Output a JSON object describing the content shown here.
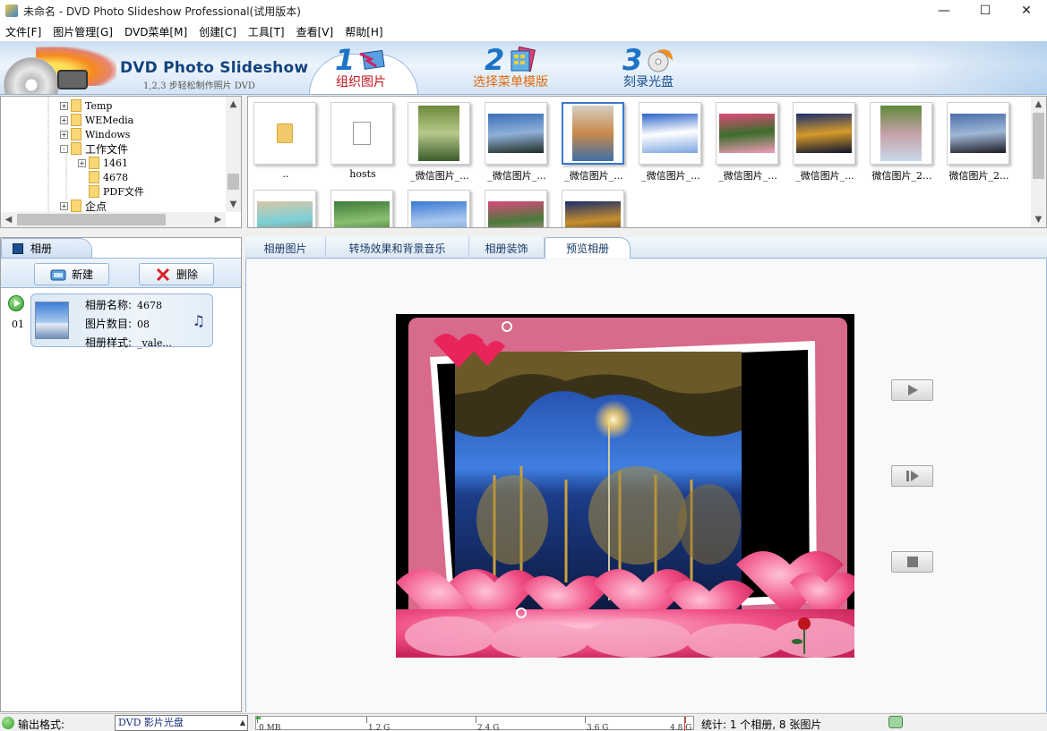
{
  "window": {
    "title": "未命名 - DVD Photo Slideshow Professional(试用版本)",
    "controls": [
      "minimize",
      "maximize",
      "close"
    ]
  },
  "menu": [
    "文件[F]",
    "图片管理[G]",
    "DVD菜单[M]",
    "创建[C]",
    "工具[T]",
    "查看[V]",
    "帮助[H]"
  ],
  "banner": {
    "brand": "DVD Photo Slideshow",
    "subtitle": "1,2,3 步轻松制作照片 DVD",
    "steps": [
      {
        "num": "1",
        "label": "组织图片",
        "active": true,
        "color": "#c0141c"
      },
      {
        "num": "2",
        "label": "选择菜单模版",
        "active": false,
        "color": "#e06a10"
      },
      {
        "num": "3",
        "label": "刻录光盘",
        "active": false,
        "color": "#1a4f8f"
      }
    ]
  },
  "tree": {
    "items": [
      {
        "label": "Temp",
        "expander": "+"
      },
      {
        "label": "WEMedia",
        "expander": "+"
      },
      {
        "label": "Windows",
        "expander": "+"
      },
      {
        "label": "工作文件",
        "expander": "-"
      },
      {
        "label": "1461",
        "expander": "+"
      },
      {
        "label": "4678",
        "expander": ""
      },
      {
        "label": "PDF文件",
        "expander": ""
      },
      {
        "label": "企点",
        "expander": "+"
      }
    ]
  },
  "thumbnails": [
    {
      "label": "..",
      "kind": "folder"
    },
    {
      "label": "hosts",
      "kind": "file"
    },
    {
      "label": "_微信图片_...",
      "kind": "photo",
      "colors": [
        "#6c8a3a",
        "#b6c98a",
        "#3a5a2a"
      ]
    },
    {
      "label": "_微信图片_...",
      "kind": "photo",
      "colors": [
        "#3a6fb8",
        "#8fb0d8",
        "#1f2d22"
      ]
    },
    {
      "label": "_微信图片_...",
      "kind": "photo",
      "colors": [
        "#d5cfc3",
        "#c88a4a",
        "#3e6fa8"
      ],
      "selected": true
    },
    {
      "label": "_微信图片_...",
      "kind": "photo",
      "colors": [
        "#2b63c9",
        "#ffffff",
        "#7aa6e0"
      ]
    },
    {
      "label": "_微信图片_...",
      "kind": "photo",
      "colors": [
        "#e04a7a",
        "#3c6e2c",
        "#f29bb8"
      ]
    },
    {
      "label": "_微信图片_...",
      "kind": "photo",
      "colors": [
        "#1a2e6e",
        "#d59a2a",
        "#0d1430"
      ]
    },
    {
      "label": "微信图片_2...",
      "kind": "photo",
      "colors": [
        "#5f8a3c",
        "#c6a0a6",
        "#c8d8ea"
      ]
    },
    {
      "label": "微信图片_2...",
      "kind": "photo",
      "colors": [
        "#4a6ea8",
        "#9fb7d6",
        "#1c1c24"
      ]
    },
    {
      "label": "",
      "kind": "photo",
      "colors": [
        "#d9c7a8",
        "#7ad0d8",
        "#a46a3a"
      ]
    },
    {
      "label": "",
      "kind": "photo",
      "colors": [
        "#3e7a3a",
        "#8ac070",
        "#2b4d22"
      ]
    },
    {
      "label": "",
      "kind": "photo",
      "colors": [
        "#3a78d4",
        "#a8c8ee",
        "#6a9ad6"
      ]
    },
    {
      "label": "",
      "kind": "photo",
      "colors": [
        "#d84a7c",
        "#4a7a3a",
        "#f0a0c0"
      ]
    },
    {
      "label": "",
      "kind": "photo",
      "colors": [
        "#1c2e6a",
        "#c88f2c",
        "#0f1530"
      ]
    }
  ],
  "album_panel": {
    "tab": "相册",
    "new_button": "新建",
    "delete_button": "删除",
    "albums": [
      {
        "index": "01",
        "name_label": "相册名称:",
        "name": "4678",
        "count_label": "图片数目:",
        "count": "08",
        "style_label": "相册样式:",
        "style": "_vale..."
      }
    ]
  },
  "tabs": [
    {
      "label": "相册图片",
      "active": false
    },
    {
      "label": "转场效果和背景音乐",
      "active": false
    },
    {
      "label": "相册装饰",
      "active": false
    },
    {
      "label": "预览相册",
      "active": true
    }
  ],
  "preview": {
    "controls": [
      "play-icon",
      "step-forward-icon",
      "stop-icon"
    ]
  },
  "statusbar": {
    "format_label": "输出格式:",
    "format_value": "DVD 影片光盘",
    "capacity_ticks": [
      "0 MB",
      "1.2 G",
      "2.4 G",
      "3.6 G",
      "4.8 G"
    ],
    "stats": "统计: 1 个相册, 8 张图片"
  }
}
